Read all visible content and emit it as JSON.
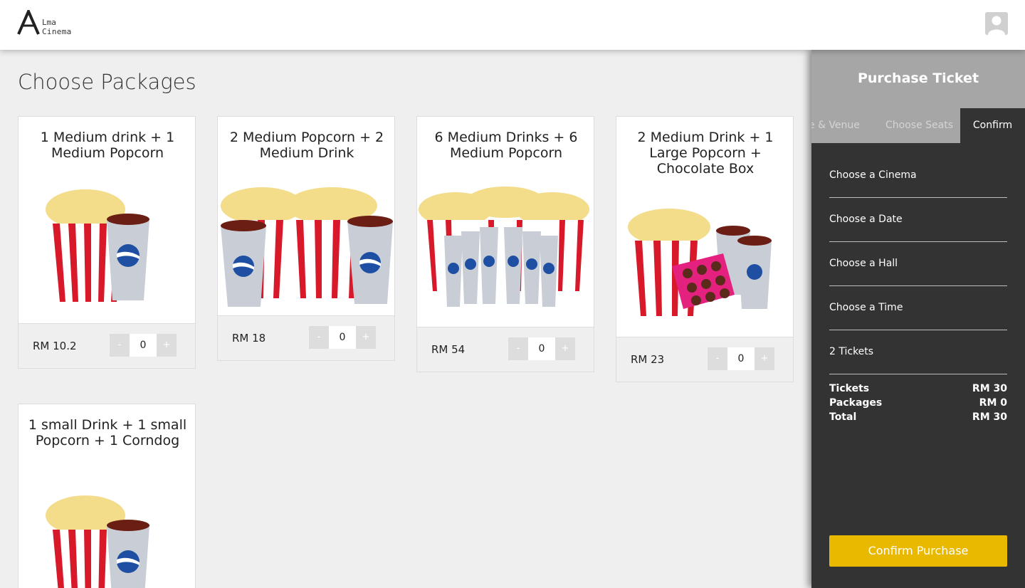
{
  "header": {
    "logo_line1": "Lma",
    "logo_line2": "Cinema"
  },
  "main": {
    "title": "Choose Packages",
    "packages": [
      {
        "title": "1 Medium drink + 1 Medium Popcorn",
        "price": "RM 10.2",
        "qty": "0",
        "minus": "-",
        "plus": "+"
      },
      {
        "title": "2 Medium Popcorn + 2 Medium Drink",
        "price": "RM 18",
        "qty": "0",
        "minus": "-",
        "plus": "+"
      },
      {
        "title": "6 Medium Drinks + 6 Medium Popcorn",
        "price": "RM 54",
        "qty": "0",
        "minus": "-",
        "plus": "+"
      },
      {
        "title": "2 Medium Drink + 1 Large Popcorn + Chocolate Box",
        "price": "RM 23",
        "qty": "0",
        "minus": "-",
        "plus": "+"
      },
      {
        "title": "1 small Drink + 1 small Popcorn + 1 Corndog"
      }
    ]
  },
  "panel": {
    "title": "Purchase Ticket",
    "steps": [
      "e & Venue",
      "Choose Seats",
      "Confirm"
    ],
    "fields": [
      "Choose a Cinema",
      "Choose a Date",
      "Choose a Hall",
      "Choose a Time",
      "2 Tickets"
    ],
    "summary": [
      {
        "label": "Tickets",
        "amount": "RM 30"
      },
      {
        "label": "Packages",
        "amount": "RM 0"
      },
      {
        "label": "Total",
        "amount": "RM 30"
      }
    ],
    "confirm_label": "Confirm Purchase"
  },
  "colors": {
    "accent": "#e9b900",
    "panel_bg": "#333333",
    "panel_header": "#a6a6a6"
  }
}
